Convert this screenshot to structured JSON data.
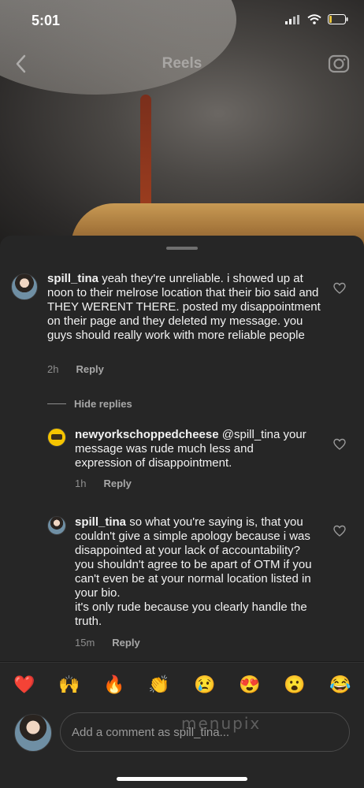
{
  "status": {
    "time": "5:01"
  },
  "header": {
    "title": "Reels"
  },
  "comments": [
    {
      "username": "spill_tina",
      "text": "yeah they're unreliable. i showed up at noon to their melrose location that their bio said and THEY WERENT THERE. posted my disappointment on their page and they deleted my message. you guys should really work with more reliable people",
      "time": "2h",
      "reply_label": "Reply"
    }
  ],
  "hide_replies_label": "Hide replies",
  "replies": [
    {
      "username": "newyorkschoppedcheese",
      "mention": "@spill_tina",
      "text": "your message was rude much less and expression of disappointment.",
      "time": "1h",
      "reply_label": "Reply"
    },
    {
      "username": "spill_tina",
      "text": "so what you're saying is, that you couldn't give a simple apology because i was disappointed at your lack of accountability? you shouldn't agree to be apart of OTM if you can't even be at your normal location listed in your bio.",
      "text2": "it's only rude because you clearly handle the truth.",
      "time": "15m",
      "reply_label": "Reply"
    }
  ],
  "emoji_bar": [
    "❤️",
    "🙌",
    "🔥",
    "👏",
    "😢",
    "😍",
    "😮",
    "😂"
  ],
  "composer": {
    "placeholder": "Add a comment as spill_tina..."
  },
  "watermark": "menupix",
  "colors": {
    "sheet": "#262626",
    "muted": "#8e8e8e",
    "heart": "#e0245e"
  }
}
